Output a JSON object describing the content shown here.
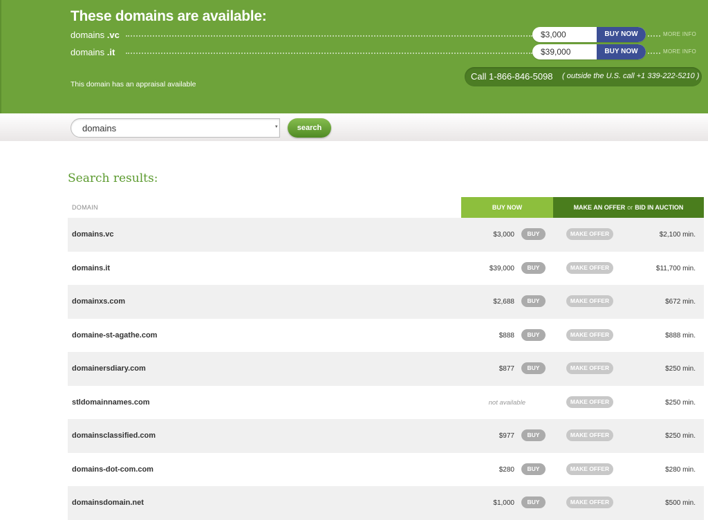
{
  "header": {
    "title": "These domains are available:",
    "domains": [
      {
        "base": "domains",
        "tld": ".vc",
        "price": "$3,000",
        "buy_label": "BUY NOW",
        "info_label": "MORE INFO"
      },
      {
        "base": "domains",
        "tld": ".it",
        "price": "$39,000",
        "buy_label": "BUY NOW",
        "info_label": "MORE INFO"
      }
    ],
    "call": "Call 1-866-846-5098",
    "call_note": "( outside the U.S. call +1 339-222-5210 )",
    "appraisal": "This domain has an appraisal available"
  },
  "search": {
    "value": "domains",
    "button": "search"
  },
  "results": {
    "title": "Search results:",
    "columns": {
      "domain": "DOMAIN",
      "buy_now": "BUY NOW",
      "make_offer": "MAKE AN OFFER",
      "or": "or",
      "bid": "BID IN AUCTION"
    },
    "buy_label": "BUY",
    "offer_label": "MAKE OFFER",
    "rows": [
      {
        "domain": "domains.vc",
        "price": "$3,000",
        "min": "$2,100 min."
      },
      {
        "domain": "domains.it",
        "price": "$39,000",
        "min": "$11,700 min."
      },
      {
        "domain": "domainxs.com",
        "price": "$2,688",
        "min": "$672 min."
      },
      {
        "domain": "domaine-st-agathe.com",
        "price": "$888",
        "min": "$888 min."
      },
      {
        "domain": "domainersdiary.com",
        "price": "$877",
        "min": "$250 min."
      },
      {
        "domain": "stldomainnames.com",
        "price": "not available",
        "min": "$250 min."
      },
      {
        "domain": "domainsclassified.com",
        "price": "$977",
        "min": "$250 min."
      },
      {
        "domain": "domains-dot-com.com",
        "price": "$280",
        "min": "$280 min."
      },
      {
        "domain": "domainsdomain.net",
        "price": "$1,000",
        "min": "$500 min."
      }
    ]
  }
}
